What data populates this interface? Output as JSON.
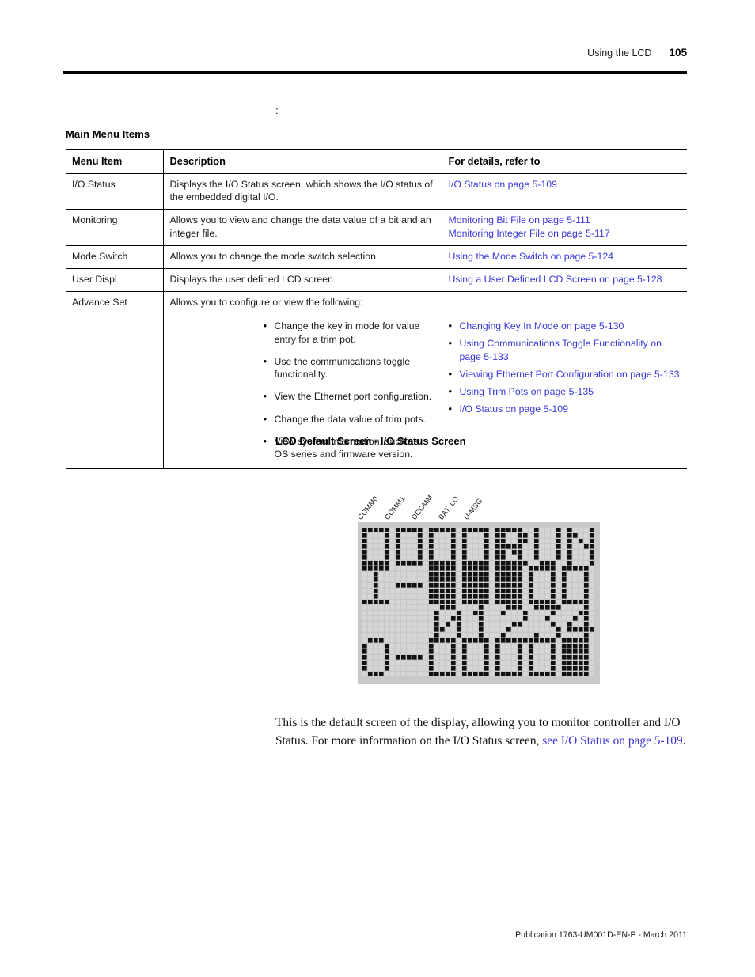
{
  "header": {
    "title": "Using the LCD",
    "page_number": "105"
  },
  "stray_marks": {
    "colon": ":",
    "dot": "."
  },
  "table": {
    "caption": "Main Menu Items",
    "columns": [
      "Menu Item",
      "Description",
      "For details, refer to"
    ],
    "rows": [
      {
        "item": "I/O Status",
        "description": "Displays the I/O Status screen, which shows the  I/O status of the embedded digital I/O.",
        "refs": [
          "I/O Status on page 5-109"
        ]
      },
      {
        "item": "Monitoring",
        "description": "Allows you to view and change the data value of a bit and an integer file.",
        "refs": [
          "Monitoring Bit File on page 5-111",
          "Monitoring Integer File on page 5-117"
        ]
      },
      {
        "item": "Mode Switch",
        "description": "Allows you to change the mode switch selection.",
        "refs": [
          "Using the Mode Switch on page 5-124"
        ]
      },
      {
        "item": "User Displ",
        "description": "Displays the user defined LCD screen",
        "refs": [
          "Using a User Defined LCD Screen on page 5-128"
        ]
      },
      {
        "item": "Advance Set",
        "description": "Allows you to configure or view the following:",
        "description_bullets": [
          "Change the key in mode for value entry for a trim pot.",
          "Use the communications toggle functionality.",
          "View the Ethernet port configuration.",
          "Change the data value of trim pots.",
          "View system information, such as OS series and firmware version."
        ],
        "ref_bullets": [
          "Changing Key In Mode on page 5-130",
          "Using Communications Toggle Functionality on page 5-133",
          "Viewing Ethernet Port Configuration on page 5-133",
          "Using Trim Pots on page 5-135",
          "I/O Status on page 5-109"
        ]
      }
    ]
  },
  "figure": {
    "heading": "LCD Default Screen - I/O Status Screen",
    "indicator_labels": [
      "COMM0",
      "COMM1",
      "DCOMM",
      "BAT. LO",
      "U-MSG"
    ],
    "lcd": {
      "line1_indicators": [
        "hollow",
        "hollow",
        "hollow",
        "hollow",
        "hollow"
      ],
      "line1_mode_text": "RUN",
      "line2_prefix": "I-",
      "line2_bits": [
        "filled",
        "filled",
        "filled",
        "hollow",
        "hollow",
        "hollow",
        "hollow",
        "hollow",
        "hollow",
        "hollow"
      ],
      "line3_digits": "0123456789",
      "line4_prefix": "O-",
      "line4_bits": [
        "hollow",
        "hollow",
        "hollow",
        "hollow",
        "filled",
        "filled"
      ],
      "bezel_color": "#c9c9c9",
      "dot_off_color": "#d6d6d6",
      "dot_on_color": "#111111"
    }
  },
  "body": {
    "text_before_link": "This is the default screen of the display, allowing you to monitor controller and I/O Status. For more information on the I/O Status screen, ",
    "link_text": "see  I/O Status on page 5-109",
    "text_after_link": "."
  },
  "footer": {
    "text": "Publication 1763-UM001D-EN-P - March 2011"
  },
  "colors": {
    "link": "#3a37d6",
    "text": "#111111",
    "rule": "#000000"
  }
}
